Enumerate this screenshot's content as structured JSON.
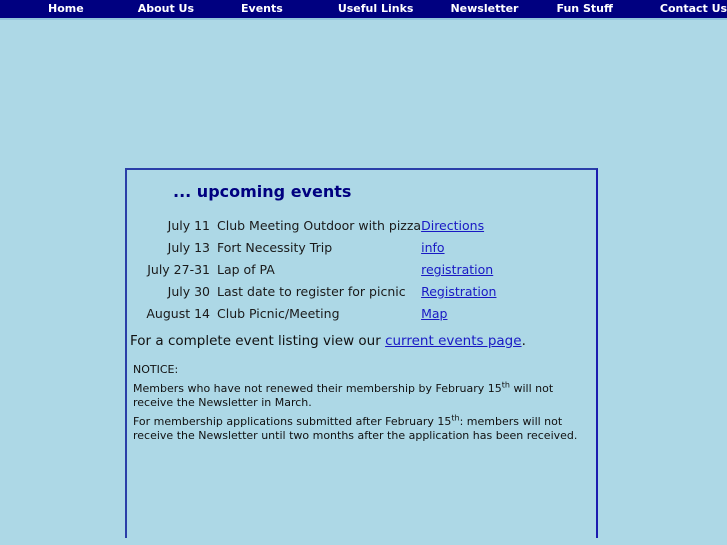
{
  "nav": {
    "items": [
      {
        "label": "Home",
        "name": "nav-item-home"
      },
      {
        "label": "About Us",
        "name": "nav-item-about-us"
      },
      {
        "label": "Events",
        "name": "nav-item-events"
      },
      {
        "label": "Useful Links",
        "name": "nav-item-useful-links"
      },
      {
        "label": "Newsletter",
        "name": "nav-item-newsletter"
      },
      {
        "label": "Fun Stuff",
        "name": "nav-item-fun-stuff"
      },
      {
        "label": "Contact Us",
        "name": "nav-item-contact-us"
      }
    ],
    "background_color": "#000080",
    "text_color": "#FFFFFF"
  },
  "panel": {
    "title": "... upcoming events",
    "title_color": "#000080",
    "border_color": "#2A3EA8",
    "background_color": "#ADD8E6"
  },
  "events": {
    "rows": [
      {
        "date": "July 11",
        "description": "Club Meeting Outdoor with pizza",
        "link": "Directions"
      },
      {
        "date": "July 13",
        "description": "Fort Necessity Trip",
        "link": "info"
      },
      {
        "date": "July 27-31",
        "description": "Lap of PA",
        "link": "registration"
      },
      {
        "date": "July 30",
        "description": "Last date to register for picnic",
        "link": "Registration"
      },
      {
        "date": "August 14",
        "description": "Club Picnic/Meeting",
        "link": "Map"
      }
    ],
    "link_color": "#1919C4"
  },
  "listing": {
    "prefix": "For a complete event listing view our ",
    "link": "current events page",
    "suffix": "."
  },
  "notice": {
    "heading": "NOTICE:",
    "paragraph1_a": "Members who have not renewed their membership by February 15",
    "paragraph1_sup": "th",
    "paragraph1_b": " will not receive the Newsletter in March.",
    "paragraph2_a": "For membership applications submitted after February 15",
    "paragraph2_sup": "th",
    "paragraph2_b": ": members will not receive the Newsletter until two months after the application has been received."
  }
}
